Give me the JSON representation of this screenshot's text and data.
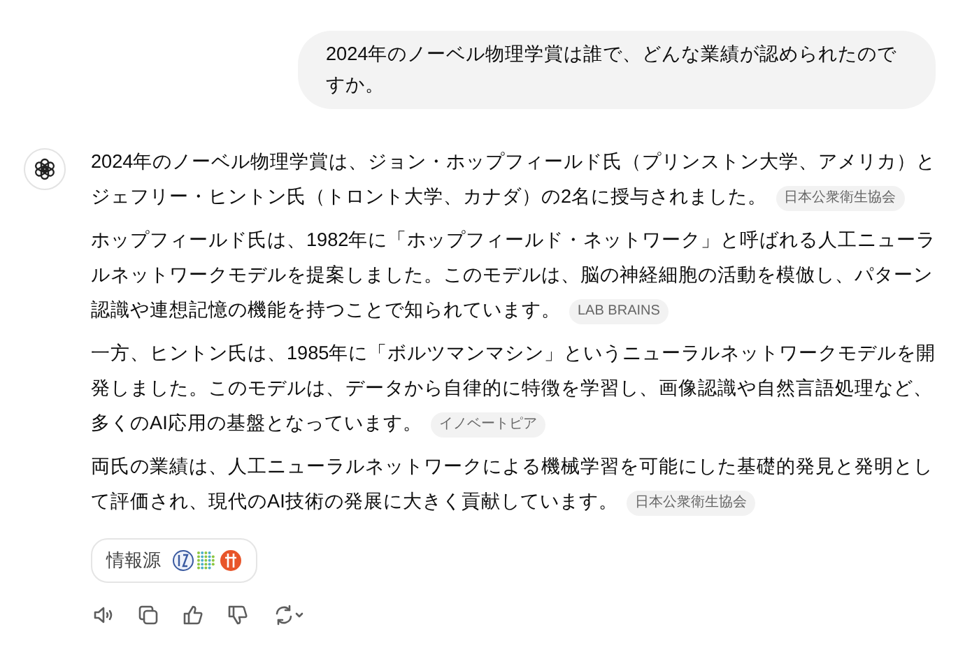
{
  "user_message": {
    "text": "2024年のノーベル物理学賞は誰で、どんな業績が認められたのですか。"
  },
  "assistant": {
    "paragraphs": [
      {
        "text": "2024年のノーベル物理学賞は、ジョン・ホップフィールド氏（プリンストン大学、アメリカ）とジェフリー・ヒントン氏（トロント大学、カナダ）の2名に授与されました。",
        "source": "日本公衆衛生協会"
      },
      {
        "text": "ホップフィールド氏は、1982年に「ホップフィールド・ネットワーク」と呼ばれる人工ニューラルネットワークモデルを提案しました。このモデルは、脳の神経細胞の活動を模倣し、パターン認識や連想記憶の機能を持つことで知られています。",
        "source": "LAB BRAINS"
      },
      {
        "text": "一方、ヒントン氏は、1985年に「ボルツマンマシン」というニューラルネットワークモデルを開発しました。このモデルは、データから自律的に特徴を学習し、画像認識や自然言語処理など、多くのAI応用の基盤となっています。",
        "source": "イノベートピア"
      },
      {
        "text": "両氏の業績は、人工ニューラルネットワークによる機械学習を可能にした基礎的発見と発明として評価され、現代のAI技術の発展に大きく貢献しています。",
        "source": "日本公衆衛生協会"
      }
    ]
  },
  "sources_button": {
    "label": "情報源"
  }
}
